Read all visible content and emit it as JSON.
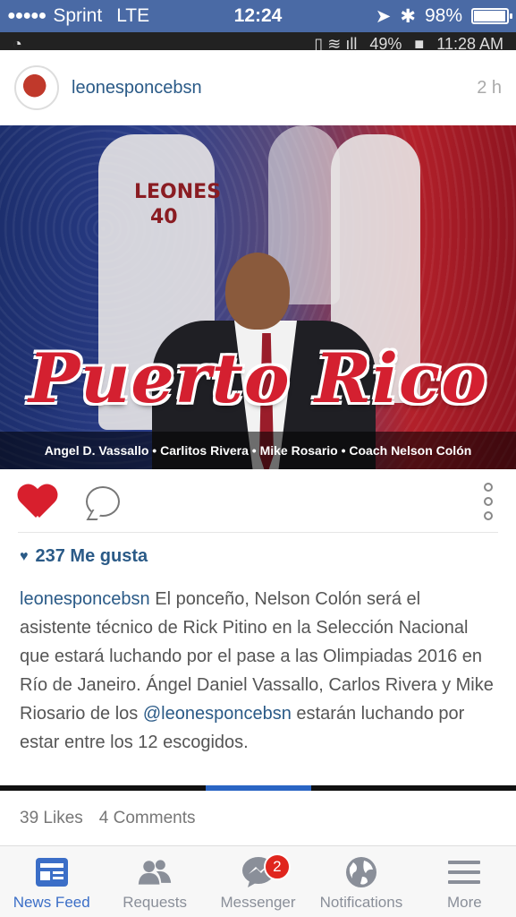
{
  "status_bar": {
    "signal": "●●●●●",
    "carrier": "Sprint",
    "network": "LTE",
    "time": "12:24",
    "battery": "98%",
    "battery_level": 0.98
  },
  "inner_status": {
    "battery": "49%",
    "time": "11:28 AM"
  },
  "post": {
    "username": "leonesponcebsn",
    "time_ago": "2 h",
    "image_title": "Puerto Rico",
    "image_caption": "Angel D. Vassallo • Carlitos Rivera • Mike Rosario • Coach Nelson Colón",
    "jersey_number": "40",
    "jersey_text": "LEONES",
    "likes": "237 Me gusta",
    "caption_user": "leonesponcebsn",
    "caption_text_1": " El ponceño, Nelson Colón será el asistente técnico de Rick Pitino en la Selección Nacional que estará luchando por el pase a las Olimpiadas 2016 en Río de Janeiro. Ángel Daniel Vassallo, Carlos Rivera y Mike Riosario de los ",
    "caption_mention": "@leonesponcebsn",
    "caption_text_2": " estarán luchando por estar entre los 12 escogidos."
  },
  "stats": {
    "likes": "39 Likes",
    "comments": "4 Comments"
  },
  "tabbar": {
    "tabs": [
      {
        "label": "News Feed",
        "icon": "news-feed-icon"
      },
      {
        "label": "Requests",
        "icon": "friends-icon"
      },
      {
        "label": "Messenger",
        "icon": "messenger-icon",
        "badge": "2"
      },
      {
        "label": "Notifications",
        "icon": "globe-icon"
      },
      {
        "label": "More",
        "icon": "menu-icon"
      }
    ]
  },
  "colors": {
    "status_bar": "#4a6aa5",
    "accent": "#3b6ec7",
    "username": "#2a5a87",
    "heart": "#d81f2d",
    "badge": "#e0261e"
  }
}
